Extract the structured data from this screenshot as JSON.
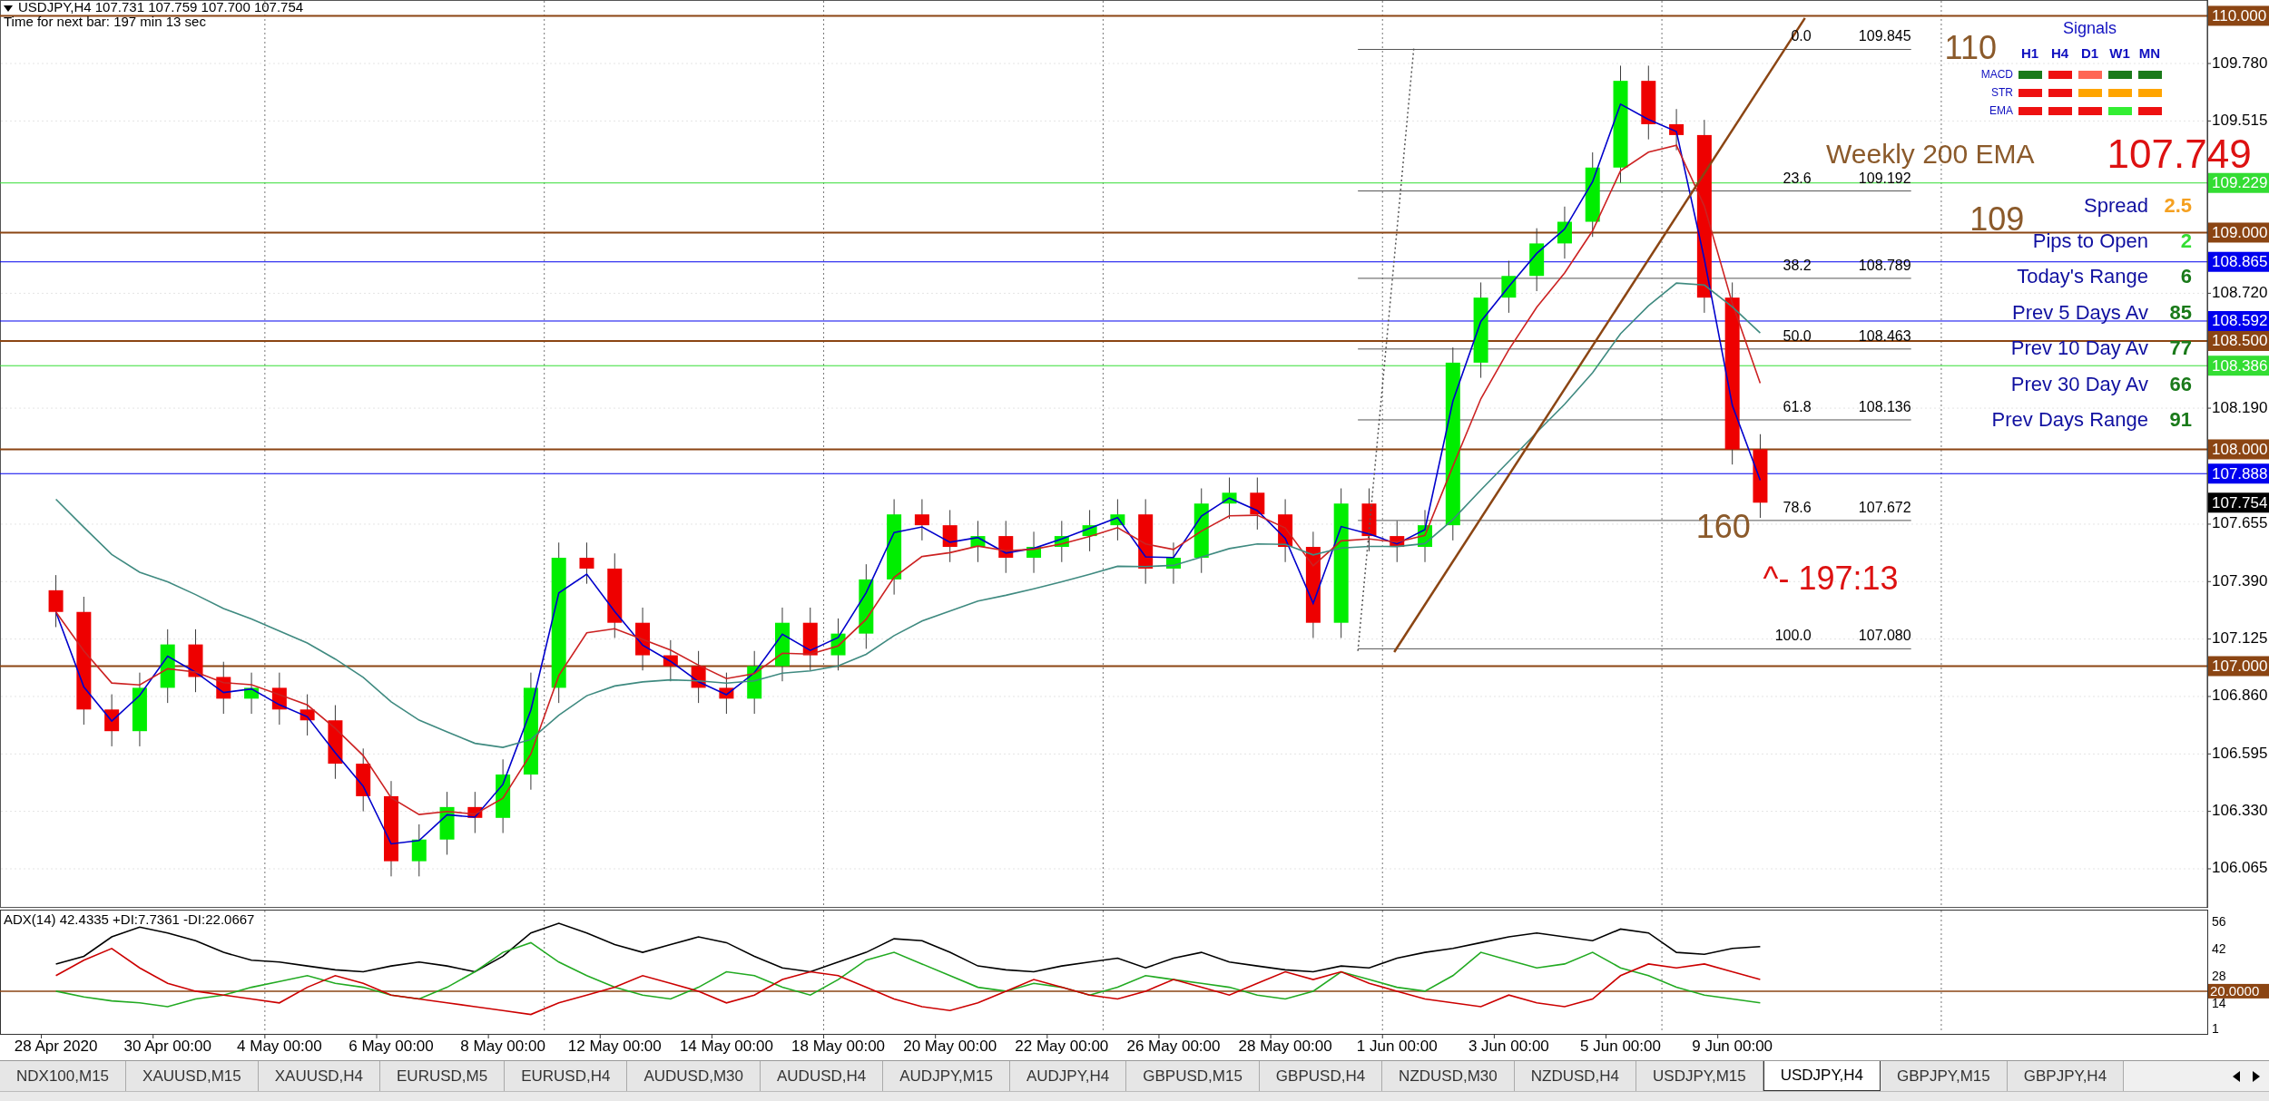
{
  "chart": {
    "symbol_line": "USDJPY,H4  107.731 107.759 107.700 107.754",
    "timer": "Time for next bar: 197 min 13 sec",
    "price_axis": [
      "109.780",
      "109.515",
      "108.720",
      "108.190",
      "107.655",
      "107.390",
      "107.125",
      "106.860",
      "106.595",
      "106.330",
      "106.065"
    ],
    "levels": [
      {
        "label": "110.000",
        "color": "#8b4513"
      },
      {
        "label": "109.229",
        "color": "#33dd33"
      },
      {
        "label": "109.000",
        "color": "#8b4513"
      },
      {
        "label": "108.865",
        "color": "#0000ee"
      },
      {
        "label": "108.592",
        "color": "#0000ee"
      },
      {
        "label": "108.500",
        "color": "#8b4513"
      },
      {
        "label": "108.386",
        "color": "#33dd33"
      },
      {
        "label": "108.000",
        "color": "#8b4513"
      },
      {
        "label": "107.888",
        "color": "#0000ee"
      },
      {
        "label": "107.754",
        "color": "#000000"
      },
      {
        "label": "107.000",
        "color": "#8b4513"
      }
    ],
    "fibonacci": [
      {
        "ratio": "0.0",
        "price": "109.845"
      },
      {
        "ratio": "23.6",
        "price": "109.192"
      },
      {
        "ratio": "38.2",
        "price": "108.789"
      },
      {
        "ratio": "50.0",
        "price": "108.463"
      },
      {
        "ratio": "61.8",
        "price": "108.136"
      },
      {
        "ratio": "78.6",
        "price": "107.672"
      },
      {
        "ratio": "100.0",
        "price": "107.080"
      }
    ],
    "labels": [
      {
        "text": "110",
        "color": "#8b5a2b"
      },
      {
        "text": "109",
        "color": "#8b5a2b"
      },
      {
        "text": "160",
        "color": "#8b5a2b"
      },
      {
        "text": "^- 197:13",
        "color": "#dd1111"
      }
    ]
  },
  "signals": {
    "title": "Signals",
    "columns": [
      "H1",
      "H4",
      "D1",
      "W1",
      "MN"
    ],
    "rows": [
      {
        "label": "MACD",
        "cells": [
          {
            "color": "#1a7a1a"
          },
          {
            "color": "#ee1111"
          },
          {
            "color": "#ff6655"
          },
          {
            "color": "#1a7a1a"
          },
          {
            "color": "#1a7a1a"
          }
        ]
      },
      {
        "label": "STR",
        "cells": [
          {
            "color": "#ee1111"
          },
          {
            "color": "#ee1111"
          },
          {
            "color": "#ffa500"
          },
          {
            "color": "#ffa500"
          },
          {
            "color": "#ffa500"
          }
        ]
      },
      {
        "label": "EMA",
        "cells": [
          {
            "color": "#ee1111"
          },
          {
            "color": "#ee1111"
          },
          {
            "color": "#ee1111"
          },
          {
            "color": "#33ee33"
          },
          {
            "color": "#ee1111"
          }
        ]
      }
    ]
  },
  "weekly_ema": {
    "label": "Weekly 200 EMA",
    "value": "107.749"
  },
  "stats": [
    {
      "label": "Spread",
      "value": "2.5",
      "color": "#f5a020"
    },
    {
      "label": "Pips to Open",
      "value": "2",
      "color": "#33dd33"
    },
    {
      "label": "Today's Range",
      "value": "6",
      "color": "#1a7a1a"
    },
    {
      "label": "Prev 5 Days Av",
      "value": "85",
      "color": "#1a7a1a"
    },
    {
      "label": "Prev 10 Day Av",
      "value": "77",
      "color": "#1a7a1a"
    },
    {
      "label": "Prev 30 Day Av",
      "value": "66",
      "color": "#1a7a1a"
    },
    {
      "label": "Prev Days Range",
      "value": "91",
      "color": "#1a7a1a"
    }
  ],
  "indicator": {
    "title": "ADX(14) 42.4335 +DI:7.7361 -DI:22.0667",
    "chart_data": {
      "type": "line",
      "categories": [
        "28 Apr 2020",
        null,
        null,
        null,
        "30 Apr 00:00",
        null,
        null,
        null,
        "4 May 00:00",
        null,
        null,
        null,
        "6 May 00:00",
        null,
        null,
        null,
        "8 May 00:00",
        null,
        null,
        null,
        "12 May 00:00",
        null,
        null,
        null,
        "14 May 00:00",
        null,
        null,
        null,
        "18 May 00:00",
        null,
        null,
        null,
        "20 May 00:00",
        null,
        null,
        null,
        "22 May 00:00",
        null,
        null,
        null,
        "26 May 00:00",
        null,
        null,
        null,
        "28 May 00:00",
        null,
        null,
        null,
        "1 Jun 00:00",
        null,
        null,
        null,
        "3 Jun 00:00",
        null,
        null,
        null,
        "5 Jun 00:00",
        null,
        null,
        null,
        "9 Jun 00:00",
        null
      ],
      "series": [
        {
          "color": "#000000",
          "values": [
            34,
            38,
            48,
            53,
            50,
            46,
            40,
            36,
            35,
            33,
            31,
            30,
            33,
            35,
            33,
            30,
            38,
            50,
            55,
            50,
            44,
            40,
            44,
            48,
            45,
            38,
            32,
            30,
            35,
            40,
            47,
            46,
            40,
            33,
            31,
            30,
            33,
            35,
            37,
            32,
            37,
            40,
            35,
            33,
            31,
            30,
            33,
            32,
            37,
            40,
            42,
            45,
            48,
            50,
            48,
            46,
            52,
            50,
            40,
            39,
            42,
            43
          ]
        },
        {
          "color": "#22aa22",
          "values": [
            20,
            17,
            15,
            14,
            12,
            16,
            18,
            22,
            25,
            28,
            24,
            22,
            18,
            16,
            22,
            30,
            40,
            45,
            35,
            28,
            22,
            18,
            16,
            22,
            30,
            28,
            22,
            18,
            26,
            36,
            40,
            34,
            28,
            22,
            20,
            24,
            22,
            18,
            22,
            28,
            26,
            24,
            22,
            18,
            16,
            20,
            30,
            26,
            22,
            20,
            28,
            40,
            36,
            32,
            34,
            40,
            32,
            28,
            22,
            18,
            16,
            14
          ]
        },
        {
          "color": "#cc0000",
          "values": [
            28,
            36,
            42,
            32,
            24,
            20,
            18,
            16,
            14,
            22,
            28,
            24,
            18,
            16,
            14,
            12,
            10,
            8,
            14,
            18,
            22,
            28,
            24,
            20,
            14,
            18,
            26,
            30,
            28,
            22,
            16,
            12,
            10,
            14,
            20,
            26,
            22,
            18,
            16,
            20,
            26,
            22,
            18,
            24,
            30,
            26,
            30,
            24,
            20,
            16,
            14,
            12,
            18,
            14,
            12,
            16,
            28,
            34,
            32,
            34,
            30,
            26
          ]
        }
      ],
      "ylim": [
        -2,
        62
      ],
      "yticks": [
        56,
        42,
        28,
        14,
        1
      ],
      "grid": true,
      "ref_lines": [
        {
          "axis": "y",
          "value": 20,
          "label": "20.0000"
        }
      ]
    }
  },
  "tabs": [
    {
      "label": "NDX100,M15",
      "selected": false
    },
    {
      "label": "XAUUSD,M15",
      "selected": false
    },
    {
      "label": "XAUUSD,H4",
      "selected": false
    },
    {
      "label": "EURUSD,M5",
      "selected": false
    },
    {
      "label": "EURUSD,H4",
      "selected": false
    },
    {
      "label": "AUDUSD,M30",
      "selected": false
    },
    {
      "label": "AUDUSD,H4",
      "selected": false
    },
    {
      "label": "AUDJPY,M15",
      "selected": false
    },
    {
      "label": "AUDJPY,H4",
      "selected": false
    },
    {
      "label": "GBPUSD,M15",
      "selected": false
    },
    {
      "label": "GBPUSD,H4",
      "selected": false
    },
    {
      "label": "NZDUSD,M30",
      "selected": false
    },
    {
      "label": "NZDUSD,H4",
      "selected": false
    },
    {
      "label": "USDJPY,M15",
      "selected": false
    },
    {
      "label": "USDJPY,H4",
      "selected": true
    },
    {
      "label": "GBPJPY,M15",
      "selected": false
    },
    {
      "label": "GBPJPY,H4",
      "selected": false
    }
  ]
}
